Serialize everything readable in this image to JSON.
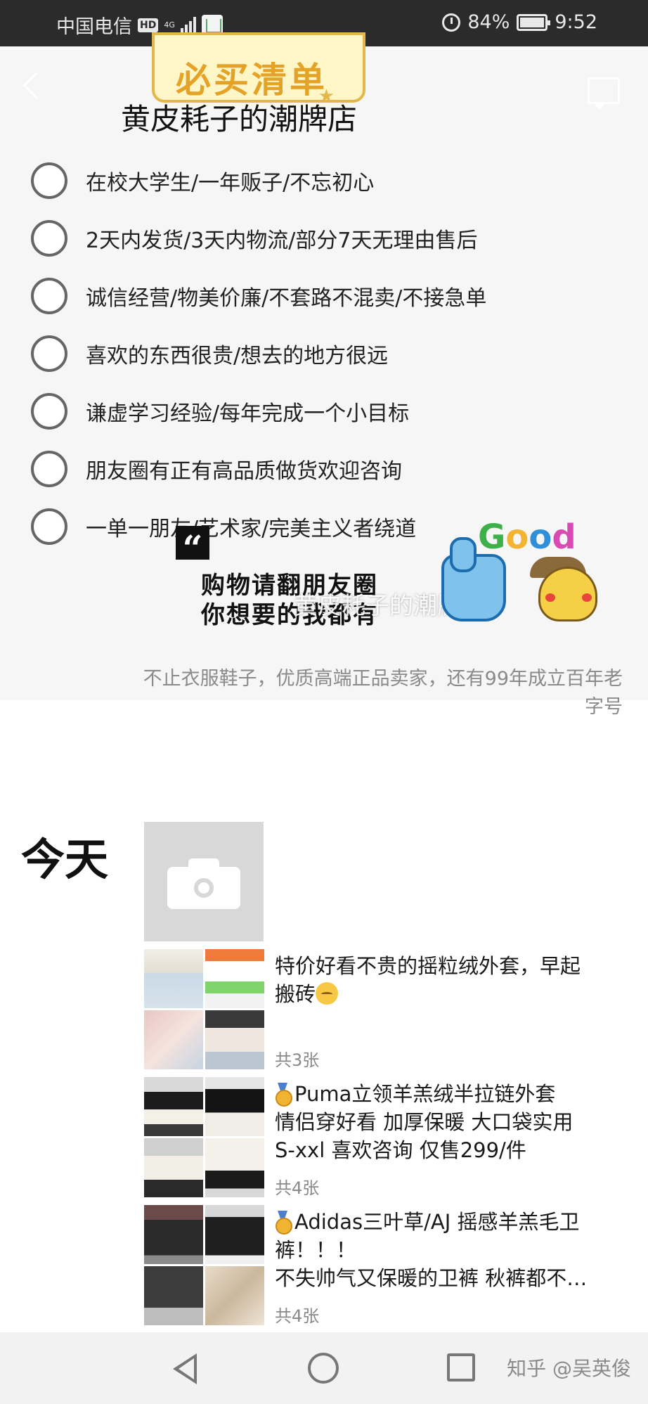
{
  "status_bar": {
    "carrier": "中国电信",
    "hd_label": "HD",
    "network_label": "4G",
    "battery_percent": "84%",
    "time": "9:52",
    "icons": [
      "hd-icon",
      "signal-icon",
      "app-icon",
      "alarm-icon",
      "battery-icon"
    ]
  },
  "cover": {
    "banner_text": "必买清单",
    "shop_title": "黄皮耗子的潮牌店",
    "checklist": [
      "在校大学生/一年贩子/不忘初心",
      "2天内发货/3天内物流/部分7天无理由售后",
      "诚信经营/物美价廉/不套路不混卖/不接急单",
      "喜欢的东西很贵/想去的地方很远",
      "谦虚学习经验/每年完成一个小目标",
      "朋友圈有正有高品质做货欢迎咨询",
      "一单一朋友/艺术家/完美主义者绕道"
    ],
    "quote_mark": "“",
    "slogan_line1": "购物请翻朋友圈",
    "slogan_line2": "你想要的我都有",
    "watermark": "黄皮耗子的潮牌店",
    "sticker_text": "Good"
  },
  "signature": "不止衣服鞋子，优质高端正品卖家，还有99年成立百年老字号",
  "feed": {
    "day_label": "今天",
    "posts": [
      {
        "text_line1": "特价好看不贵的摇粒绒外套，早起",
        "text_line2": "搬砖",
        "count": "共3张"
      },
      {
        "text_line1": "Puma立领羊羔绒半拉链外套",
        "text_line2": "情侣穿好看 加厚保暖 大口袋实用",
        "text_line3": "S-xxl 喜欢咨询 仅售299/件",
        "count": "共4张"
      },
      {
        "text_line1": "Adidas三叶草/AJ 摇感羊羔毛卫",
        "text_line2": "裤！！！",
        "text_line3": "不失帅气又保暖的卫裤 秋裤都不…",
        "count": "共4张"
      }
    ]
  },
  "nav_bar": {
    "credit": "知乎 @吴英俊",
    "icons": [
      "back-nav-icon",
      "home-nav-icon",
      "recent-apps-icon"
    ]
  },
  "colors": {
    "status_bar_bg": "#2b2b2b",
    "cover_bg": "#f6f6f6",
    "banner_accent": "#e4a227",
    "secondary_text": "#8a8a8a"
  }
}
